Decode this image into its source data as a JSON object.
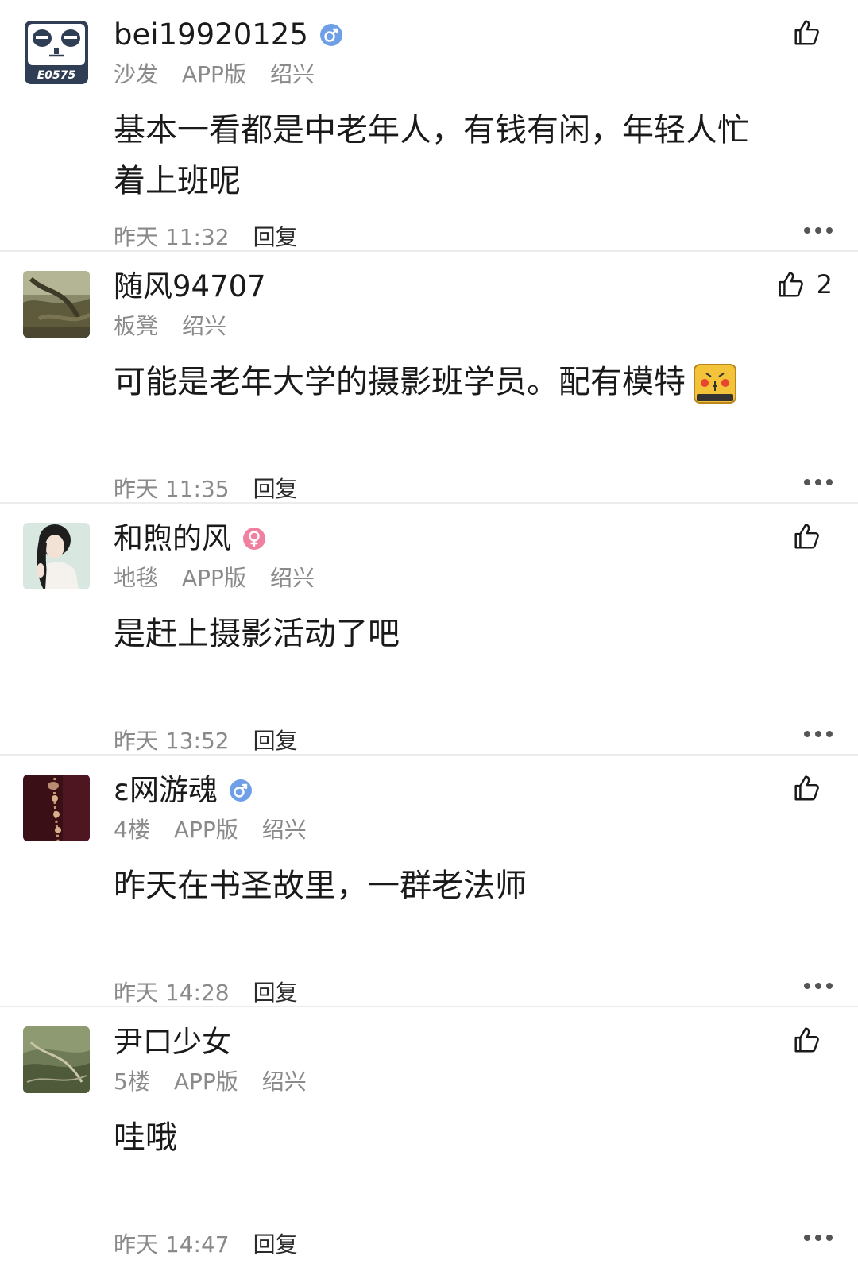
{
  "comments": [
    {
      "username": "bei19920125",
      "gender": "male",
      "meta": [
        "沙发",
        "APP版",
        "绍兴"
      ],
      "body": [
        "基本一看都是中老年人，有钱有闲，年轻人忙",
        "着上班呢"
      ],
      "time": "昨天 11:32",
      "reply": "回复",
      "likes": ""
    },
    {
      "username": "随风94707",
      "gender": "",
      "meta": [
        "板凳",
        "绍兴"
      ],
      "body": [
        "可能是老年大学的摄影班学员。配有模特"
      ],
      "time": "昨天 11:35",
      "reply": "回复",
      "likes": "2"
    },
    {
      "username": "和煦的风",
      "gender": "female",
      "meta": [
        "地毯",
        "APP版",
        "绍兴"
      ],
      "body": [
        "是赶上摄影活动了吧"
      ],
      "time": "昨天 13:52",
      "reply": "回复",
      "likes": ""
    },
    {
      "username": "ɛ网游魂",
      "gender": "male",
      "meta": [
        "4楼",
        "APP版",
        "绍兴"
      ],
      "body": [
        "昨天在书圣故里，一群老法师"
      ],
      "time": "昨天 14:28",
      "reply": "回复",
      "likes": ""
    },
    {
      "username": "尹口少女",
      "gender": "",
      "meta": [
        "5楼",
        "APP版",
        "绍兴"
      ],
      "body": [
        "哇哦"
      ],
      "time": "昨天 14:47",
      "reply": "回复",
      "likes": ""
    }
  ],
  "logo_text": "E0575",
  "colors": {
    "male": "#6f9fe6",
    "female": "#f07fa0",
    "muted": "#8a8a8a",
    "divider": "#ececec"
  },
  "icons": {
    "like": "thumbs-up-icon",
    "more": "more-dots-icon",
    "male": "male-gender-icon",
    "female": "female-gender-icon"
  }
}
